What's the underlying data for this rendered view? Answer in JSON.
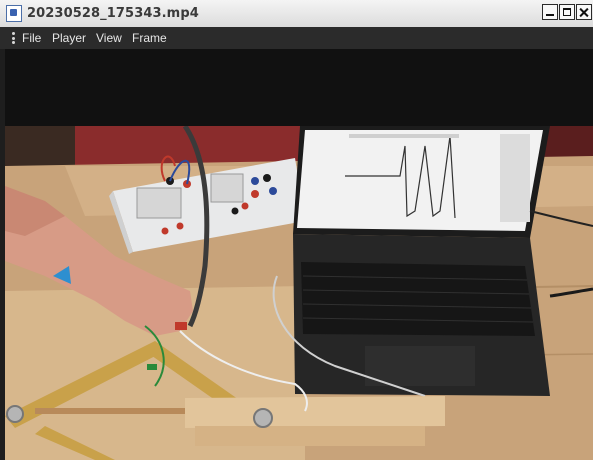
{
  "window": {
    "title": "20230528_175343.mp4",
    "icon": "video-file-icon",
    "controls": [
      "minimize-icon",
      "maximize-icon",
      "close-icon"
    ]
  },
  "menu": {
    "icon": "kebab-menu-icon",
    "items": [
      "File",
      "Player",
      "View",
      "Frame"
    ]
  },
  "video": {
    "content": "video-frame"
  }
}
